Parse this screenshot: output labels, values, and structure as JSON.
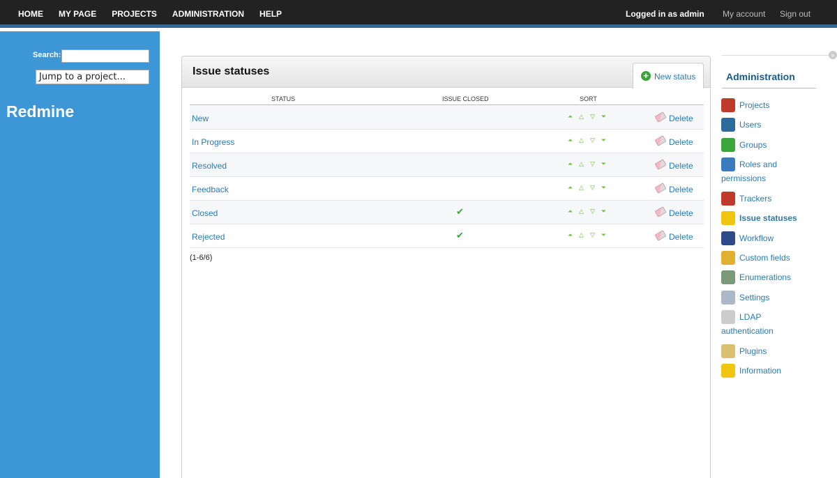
{
  "topnav": {
    "items": [
      "HOME",
      "MY PAGE",
      "PROJECTS",
      "ADMINISTRATION",
      "HELP"
    ],
    "logged_in": "Logged in as admin",
    "my_account": "My account",
    "sign_out": "Sign out"
  },
  "left": {
    "search_label": "Search:",
    "search_value": "",
    "jump": "Jump to a project...",
    "brand": "Redmine"
  },
  "main": {
    "title": "Issue statuses",
    "new_status": "New status",
    "columns": {
      "status": "STATUS",
      "closed": "ISSUE CLOSED",
      "sort": "SORT"
    },
    "rows": [
      {
        "name": "New",
        "closed": "",
        "delete": "Delete"
      },
      {
        "name": "In Progress",
        "closed": "",
        "delete": "Delete"
      },
      {
        "name": "Resolved",
        "closed": "",
        "delete": "Delete"
      },
      {
        "name": "Feedback",
        "closed": "",
        "delete": "Delete"
      },
      {
        "name": "Closed",
        "closed": "✔",
        "delete": "Delete"
      },
      {
        "name": "Rejected",
        "closed": "✔",
        "delete": "Delete"
      }
    ],
    "pagination": "(1-6/6)"
  },
  "sidebar": {
    "title": "Administration",
    "items": [
      {
        "label": "Projects",
        "icon": "projects-icon",
        "color": "#c0392b"
      },
      {
        "label": "Users",
        "icon": "users-icon",
        "color": "#2e6a9a"
      },
      {
        "label": "Groups",
        "icon": "groups-icon",
        "color": "#3aa53a"
      },
      {
        "label": "Roles and",
        "label2": "permissions",
        "icon": "roles-icon",
        "color": "#3a7bbf"
      },
      {
        "label": "Trackers",
        "icon": "trackers-icon",
        "color": "#c0392b"
      },
      {
        "label": "Issue statuses",
        "icon": "issue-statuses-icon",
        "color": "#f1c40f"
      },
      {
        "label": "Workflow",
        "icon": "workflow-icon",
        "color": "#2e4a8a"
      },
      {
        "label": "Custom fields",
        "icon": "custom-fields-icon",
        "color": "#e0b030"
      },
      {
        "label": "Enumerations",
        "icon": "enumerations-icon",
        "color": "#7a9a7a"
      },
      {
        "label": "Settings",
        "icon": "settings-icon",
        "color": "#aab8c8"
      },
      {
        "label": "LDAP",
        "label2": "authentication",
        "icon": "ldap-icon",
        "color": "#cccccc"
      },
      {
        "label": "Plugins",
        "icon": "plugins-icon",
        "color": "#d8c070"
      },
      {
        "label": "Information",
        "icon": "information-icon",
        "color": "#f1c40f"
      }
    ]
  }
}
